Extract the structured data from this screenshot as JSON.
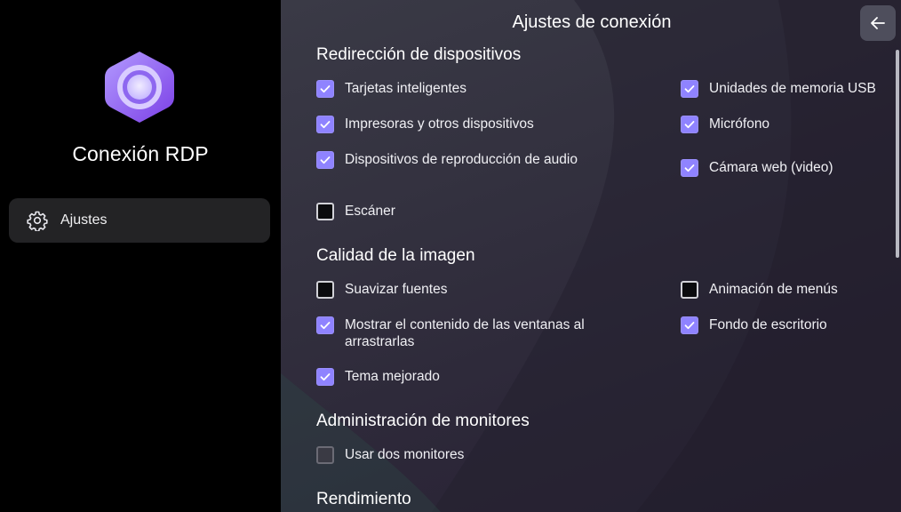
{
  "app": {
    "title": "Conexión RDP",
    "logo_icon": "rdp-logo-icon"
  },
  "sidebar": {
    "items": [
      {
        "label": "Ajustes",
        "icon": "gear-icon",
        "selected": true
      }
    ]
  },
  "header": {
    "title": "Ajustes de conexión",
    "back_icon": "arrow-left-icon"
  },
  "sections": [
    {
      "title": "Redirección de dispositivos",
      "options": [
        {
          "label": "Tarjetas inteligentes",
          "checked": true
        },
        {
          "label": "Unidades de memoria USB",
          "checked": true
        },
        {
          "label": "Impresoras y otros dispositivos",
          "checked": true
        },
        {
          "label": "Micrófono",
          "checked": true
        },
        {
          "label": "Dispositivos de reproducción de audio",
          "checked": true
        },
        {
          "label": "Cámara web (video)",
          "checked": true
        },
        {
          "label": "Escáner",
          "checked": false
        }
      ]
    },
    {
      "title": "Calidad de la imagen",
      "options": [
        {
          "label": "Suavizar fuentes",
          "checked": false
        },
        {
          "label": "Animación de menús",
          "checked": false
        },
        {
          "label": "Mostrar el contenido de las ventanas al arrastrarlas",
          "checked": true
        },
        {
          "label": "Fondo de escritorio",
          "checked": true
        },
        {
          "label": "Tema mejorado",
          "checked": true
        }
      ]
    },
    {
      "title": "Administración de monitores",
      "options": [
        {
          "label": "Usar dos monitores",
          "checked": false,
          "disabled": true
        }
      ]
    },
    {
      "title": "Rendimiento",
      "options": []
    }
  ],
  "colors": {
    "accent": "#8f83ff",
    "sidebar_bg": "#000000",
    "nav_selected_bg": "#232325"
  }
}
